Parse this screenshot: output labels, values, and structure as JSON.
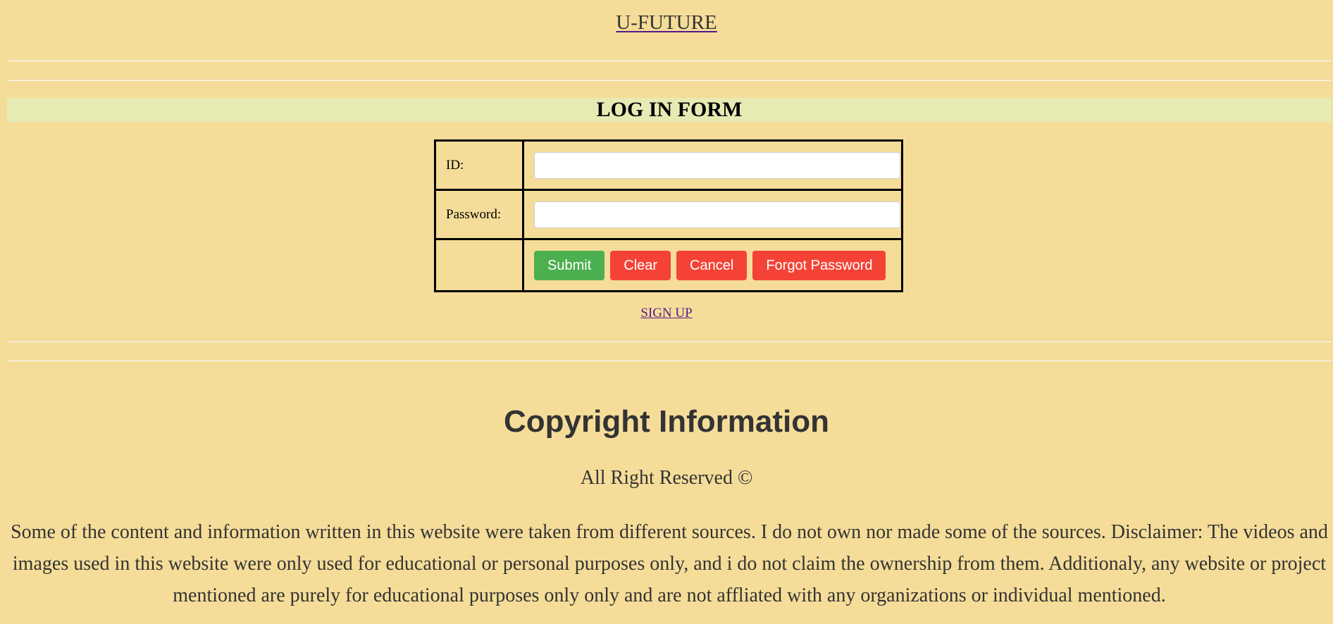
{
  "header": {
    "site_title": "U-FUTURE"
  },
  "login_form": {
    "heading": "LOG IN FORM",
    "id_label": "ID:",
    "id_value": "",
    "password_label": "Password:",
    "password_value": "",
    "buttons": {
      "submit": "Submit",
      "clear": "Clear",
      "cancel": "Cancel",
      "forgot": "Forgot Password"
    },
    "signup_link": "SIGN UP"
  },
  "footer": {
    "copyright_title": "Copyright Information",
    "rights": "All Right Reserved ©",
    "disclaimer": "Some of the content and information written in this website were taken from different sources. I do not own nor made some of the sources. Disclaimer: The videos and images used in this website were only used for educational or personal purposes only, and i do not claim the ownership from them. Additionaly, any website or project mentioned are purely for educational purposes only only and are not affliated with any organizations or individual mentioned."
  },
  "colors": {
    "page_background": "#f5dd99",
    "heading_band": "#e6ebb4",
    "submit_button": "#4caf50",
    "action_buttons": "#f44336"
  }
}
